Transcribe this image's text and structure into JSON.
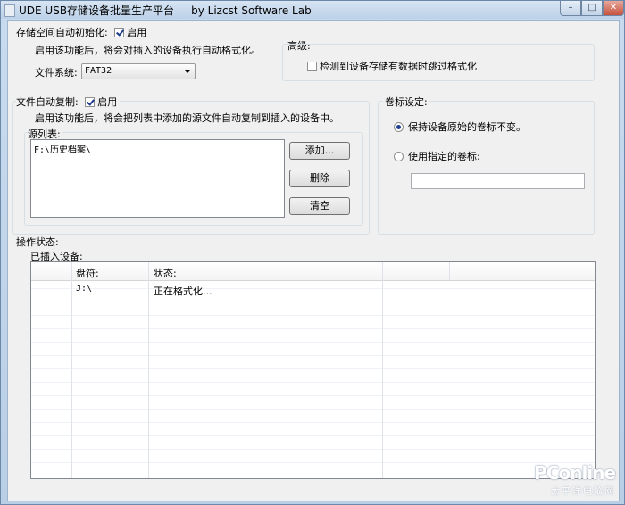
{
  "window": {
    "title": "UDE USB存储设备批量生产平台     by Lizcst Software Lab"
  },
  "auto_format": {
    "group_label": "存储空间自动初始化:",
    "enable_label": "启用",
    "enabled": true,
    "description": "启用该功能后，将会对插入的设备执行自动格式化。",
    "fs_label": "文件系统:",
    "fs_value": "FAT32"
  },
  "advanced": {
    "group_label": "高级:",
    "skip_format_label": "检测到设备存储有数据时跳过格式化",
    "skip_format_checked": false
  },
  "auto_copy": {
    "group_label": "文件自动复制:",
    "enable_label": "启用",
    "enabled": true,
    "description": "启用该功能后，将会把列表中添加的源文件自动复制到插入的设备中。",
    "source_list_label": "源列表:",
    "source_items": [
      "F:\\历史档案\\"
    ],
    "add_button": "添加...",
    "delete_button": "删除",
    "clear_button": "清空"
  },
  "volume_label": {
    "group_label": "卷标设定:",
    "option_keep": "保持设备原始的卷标不变。",
    "option_custom": "使用指定的卷标:",
    "selected": "keep",
    "custom_value": ""
  },
  "status": {
    "group_label": "操作状态:",
    "devices_label": "已插入设备:",
    "columns": [
      "",
      "盘符:",
      "状态:",
      ""
    ],
    "rows": [
      [
        "",
        "J:\\",
        "正在格式化..."
      ]
    ]
  },
  "watermark": {
    "logo": "PConline",
    "sub": "太平洋电脑网"
  }
}
